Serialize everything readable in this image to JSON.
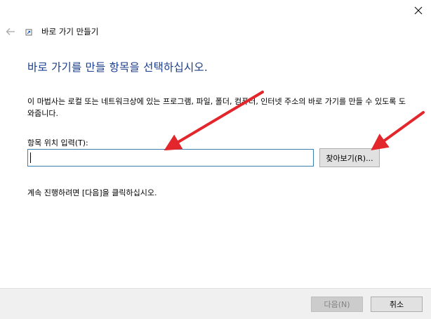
{
  "window": {
    "title": "바로 가기 만들기",
    "close_icon": "close-icon",
    "back_icon": "back-arrow-icon",
    "app_icon": "shortcut-icon"
  },
  "main": {
    "heading": "바로 가기를 만들 항목을 선택하십시오.",
    "description": "이 마법사는 로컬 또는 네트워크상에 있는 프로그램, 파일, 폴더, 컴퓨터, 인터넷 주소의 바로 가기를 만들 수 있도록 도와줍니다.",
    "field_label": "항목 위치 입력(T):",
    "location_value": "",
    "browse_label": "찾아보기(R)...",
    "continue_hint": "계속 진행하려면 [다음]을 클릭하십시오."
  },
  "footer": {
    "next_label": "다음(N)",
    "cancel_label": "취소"
  },
  "colors": {
    "heading": "#1a3e8c",
    "input_border": "#3c7fb1",
    "annotation_arrow": "#e3262b",
    "footer_bg": "#f0f0f0"
  }
}
